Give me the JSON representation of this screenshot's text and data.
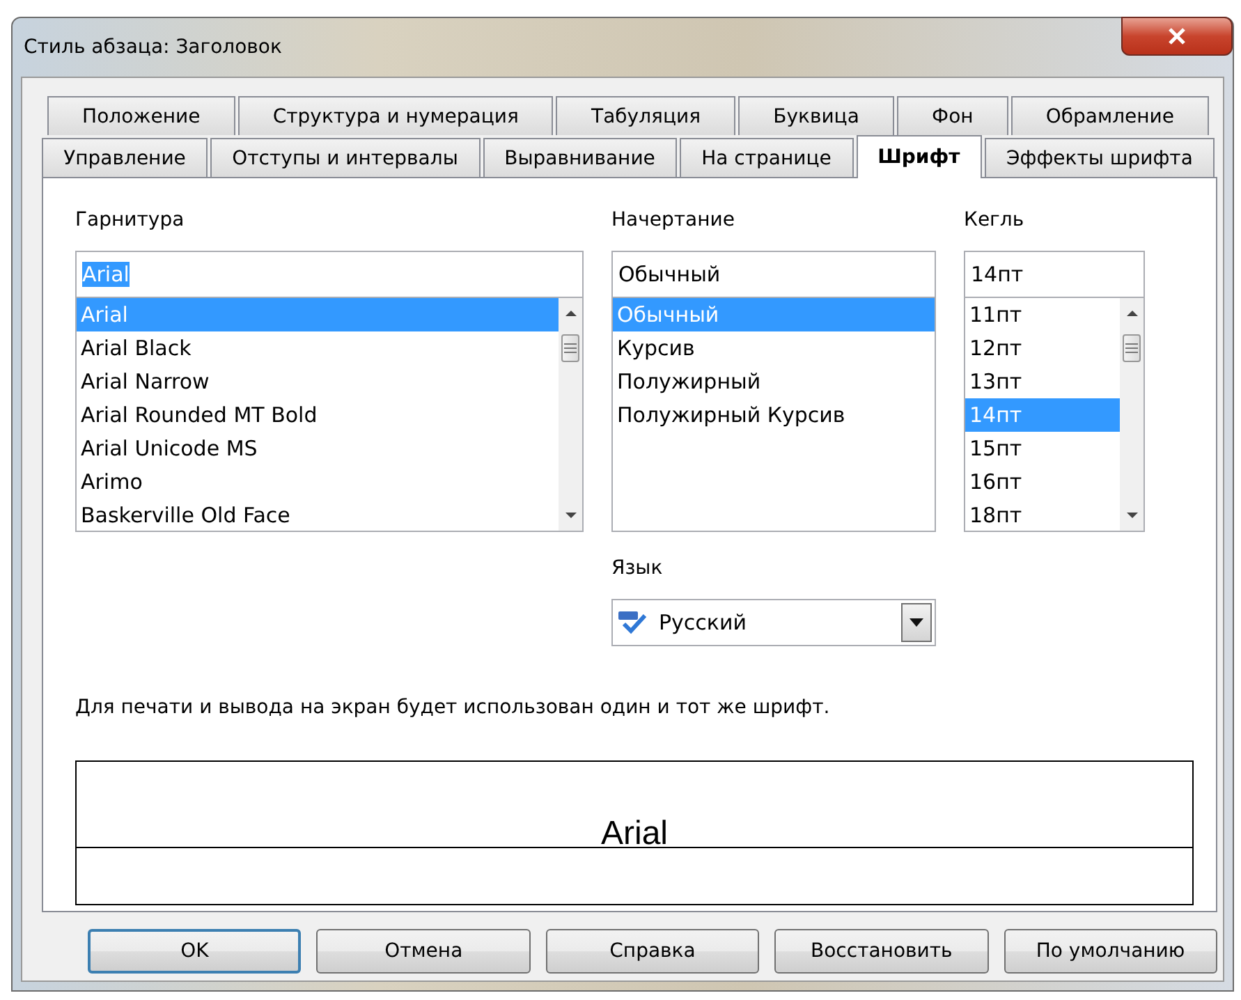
{
  "window": {
    "title": "Стиль абзаца: Заголовок"
  },
  "tab_rows": [
    [
      {
        "label": "Положение",
        "selected": false
      },
      {
        "label": "Структура и нумерация",
        "selected": false
      },
      {
        "label": "Табуляция",
        "selected": false
      },
      {
        "label": "Буквица",
        "selected": false
      },
      {
        "label": "Фон",
        "selected": false
      },
      {
        "label": "Обрамление",
        "selected": false
      }
    ],
    [
      {
        "label": "Управление",
        "selected": false
      },
      {
        "label": "Отступы и интервалы",
        "selected": false
      },
      {
        "label": "Выравнивание",
        "selected": false
      },
      {
        "label": "На странице",
        "selected": false
      },
      {
        "label": "Шрифт",
        "selected": true
      },
      {
        "label": "Эффекты шрифта",
        "selected": false
      }
    ]
  ],
  "family": {
    "label": "Гарнитура",
    "value": "Arial",
    "value_highlighted": true,
    "scrollable": true,
    "items": [
      {
        "text": "Arial",
        "selected": true
      },
      {
        "text": "Arial Black",
        "selected": false
      },
      {
        "text": "Arial Narrow",
        "selected": false
      },
      {
        "text": "Arial Rounded MT Bold",
        "selected": false
      },
      {
        "text": "Arial Unicode MS",
        "selected": false
      },
      {
        "text": "Arimo",
        "selected": false
      },
      {
        "text": "Baskerville Old Face",
        "selected": false
      }
    ]
  },
  "style": {
    "label": "Начертание",
    "value": "Обычный",
    "value_highlighted": false,
    "scrollable": false,
    "items": [
      {
        "text": "Обычный",
        "selected": true
      },
      {
        "text": "Курсив",
        "selected": false
      },
      {
        "text": "Полужирный",
        "selected": false
      },
      {
        "text": "Полужирный Курсив",
        "selected": false
      }
    ]
  },
  "size": {
    "label": "Кегль",
    "value": "14пт",
    "value_highlighted": false,
    "scrollable": true,
    "items": [
      {
        "text": "11пт",
        "selected": false
      },
      {
        "text": "12пт",
        "selected": false
      },
      {
        "text": "13пт",
        "selected": false
      },
      {
        "text": "14пт",
        "selected": true
      },
      {
        "text": "15пт",
        "selected": false
      },
      {
        "text": "16пт",
        "selected": false
      },
      {
        "text": "18пт",
        "selected": false
      }
    ]
  },
  "language": {
    "label": "Язык",
    "value": "Русский"
  },
  "note": "Для печати и вывода на экран будет использован один и тот же шрифт.",
  "preview": {
    "text": "Arial"
  },
  "buttons": [
    {
      "label": "OK",
      "default": true
    },
    {
      "label": "Отмена",
      "default": false
    },
    {
      "label": "Справка",
      "default": false
    },
    {
      "label": "Восстановить",
      "default": false
    },
    {
      "label": "По умолчанию",
      "default": false
    }
  ]
}
